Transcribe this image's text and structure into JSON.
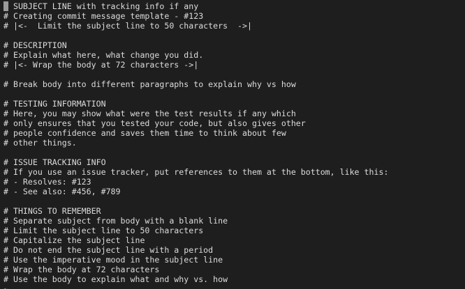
{
  "editor": {
    "lines": [
      "# SUBJECT LINE with tracking info if any",
      "# Creating commit message template - #123",
      "# |<-  Limit the subject line to 50 characters  ->|",
      "",
      "# DESCRIPTION",
      "# Explain what here, what change you did.",
      "# |<- Wrap the body at 72 characters ->|",
      "",
      "# Break body into different paragraphs to explain why vs how",
      "",
      "# TESTING INFORMATION",
      "# Here, you may show what were the test results if any which",
      "# only ensures that you tested your code, but also gives other",
      "# people confidence and saves them time to think about few",
      "# other things.",
      "",
      "# ISSUE TRACKING INFO",
      "# If you use an issue tracker, put references to them at the bottom, like this:",
      "# - Resolves: #123",
      "# - See also: #456, #789",
      "",
      "# THINGS TO REMEMBER",
      "# Separate subject from body with a blank line",
      "# Limit the subject line to 50 characters",
      "# Capitalize the subject line",
      "# Do not end the subject line with a period",
      "# Use the imperative mood in the subject line",
      "# Wrap the body at 72 characters",
      "# Use the body to explain what and why vs. how"
    ],
    "partial_line": "~"
  }
}
